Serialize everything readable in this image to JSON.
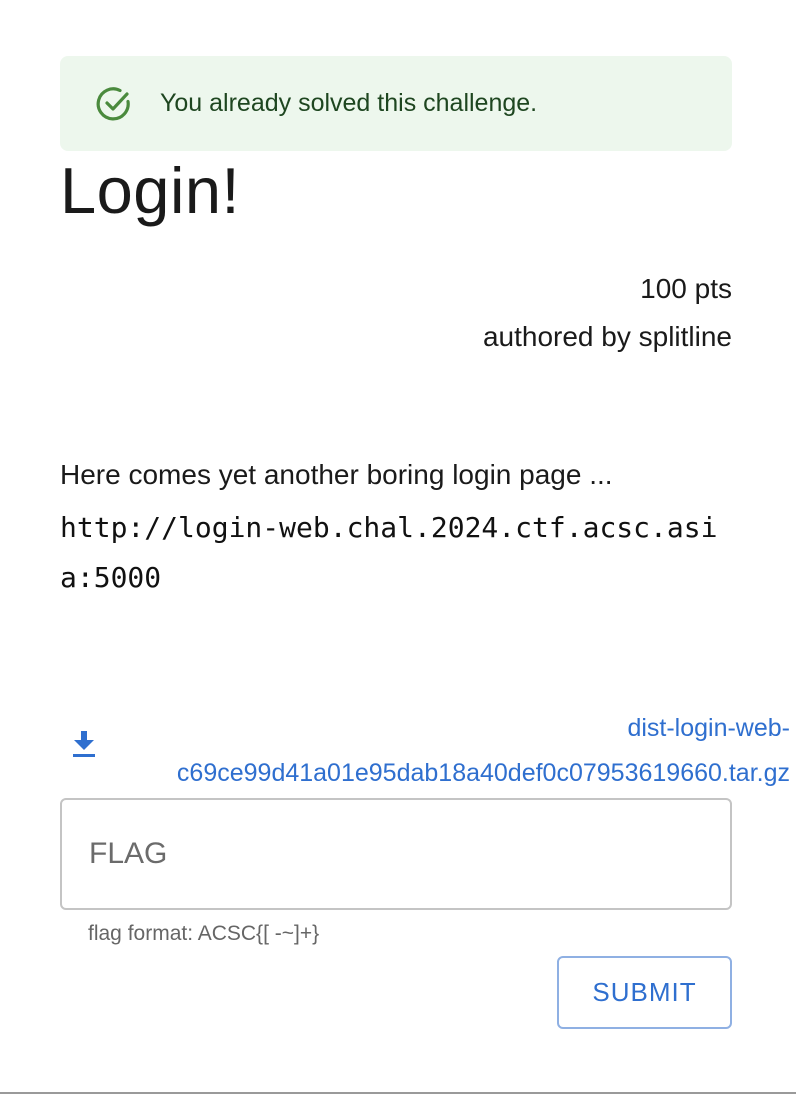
{
  "alert": {
    "icon": "check-circle-icon",
    "text": "You already solved this challenge.",
    "color": "#4a8a3d"
  },
  "challenge": {
    "title": "Login!",
    "points": "100 pts",
    "author": "authored by splitline",
    "description": "Here comes yet another boring login page ...",
    "url": "http://login-web.chal.2024.ctf.acsc.asia:5000"
  },
  "download": {
    "icon": "download-icon",
    "filename": "dist-login-web-c69ce99d41a01e95dab18a40def0c07953619660.tar.gz",
    "color": "#2f6fcf"
  },
  "flag_form": {
    "placeholder": "FLAG",
    "helper": "flag format: ACSC{[ -~]+}",
    "submit_label": "SUBMIT"
  }
}
